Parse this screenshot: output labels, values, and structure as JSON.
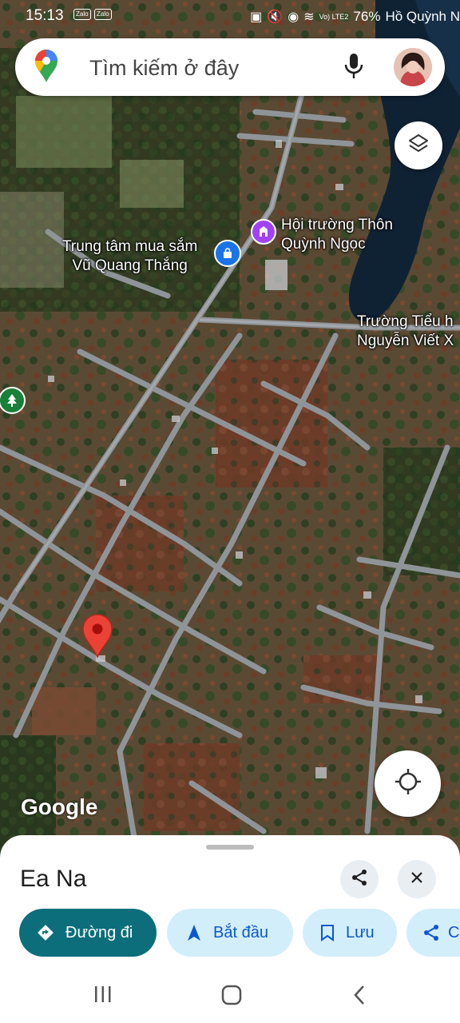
{
  "status_bar": {
    "time": "15:13",
    "apps": [
      "Zalo",
      "Zalo"
    ],
    "network": "Vo) LTE2",
    "battery": "76%",
    "location_overlay": "Hồ Quỳnh N"
  },
  "search": {
    "placeholder": "Tìm kiếm ở đây"
  },
  "map": {
    "labels": {
      "hoi_truong": "Hội trường Thôn\nQuỳnh Ngọc",
      "trung_tam": "Trung tâm mua sắm\nVũ Quang Thắng",
      "truong": "Trường Tiểu h\nNguyễn Viết X"
    },
    "attribution": "Google",
    "colors": {
      "marker": "#ea4335",
      "poi_shopping": "#1a73e8",
      "poi_civic": "#a142f4",
      "poi_park": "#188038"
    }
  },
  "place_sheet": {
    "title": "Ea Na",
    "actions": [
      {
        "label": "Đường đi",
        "icon": "directions-icon"
      },
      {
        "label": "Bắt đầu",
        "icon": "navigation-arrow-icon"
      },
      {
        "label": "Lưu",
        "icon": "bookmark-icon"
      },
      {
        "label": "C",
        "icon": "share-icon"
      }
    ]
  }
}
